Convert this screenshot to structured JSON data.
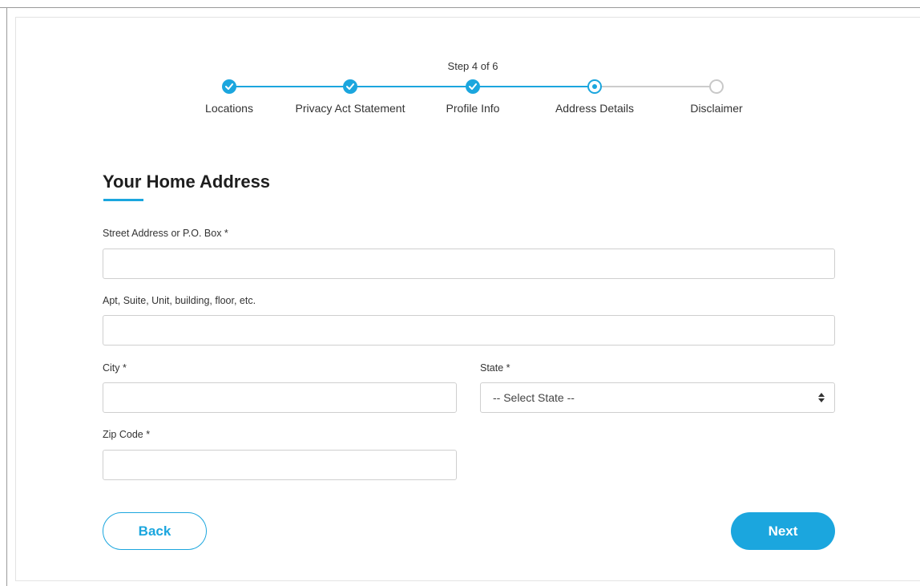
{
  "stepper": {
    "indicator": "Step 4 of 6",
    "steps": [
      {
        "label": "Locations",
        "state": "complete"
      },
      {
        "label": "Privacy Act Statement",
        "state": "complete"
      },
      {
        "label": "Profile Info",
        "state": "complete"
      },
      {
        "label": "Address Details",
        "state": "current"
      },
      {
        "label": "Disclaimer",
        "state": "future"
      }
    ]
  },
  "form": {
    "title": "Your Home Address",
    "street": {
      "label": "Street Address or P.O. Box *",
      "value": ""
    },
    "apt": {
      "label": "Apt, Suite, Unit, building, floor, etc.",
      "value": ""
    },
    "city": {
      "label": "City *",
      "value": ""
    },
    "state": {
      "label": "State *",
      "selected": "-- Select State --"
    },
    "zip": {
      "label": "Zip Code *",
      "value": ""
    }
  },
  "actions": {
    "back_label": "Back",
    "next_label": "Next"
  },
  "colors": {
    "accent": "#1ba6de",
    "inactive": "#c8c8c8",
    "text": "#333333"
  },
  "icons": {
    "step_complete": "check-icon",
    "step_current": "radio-dot-icon",
    "step_future": "empty-circle-icon",
    "select": "sort-arrows-icon"
  }
}
